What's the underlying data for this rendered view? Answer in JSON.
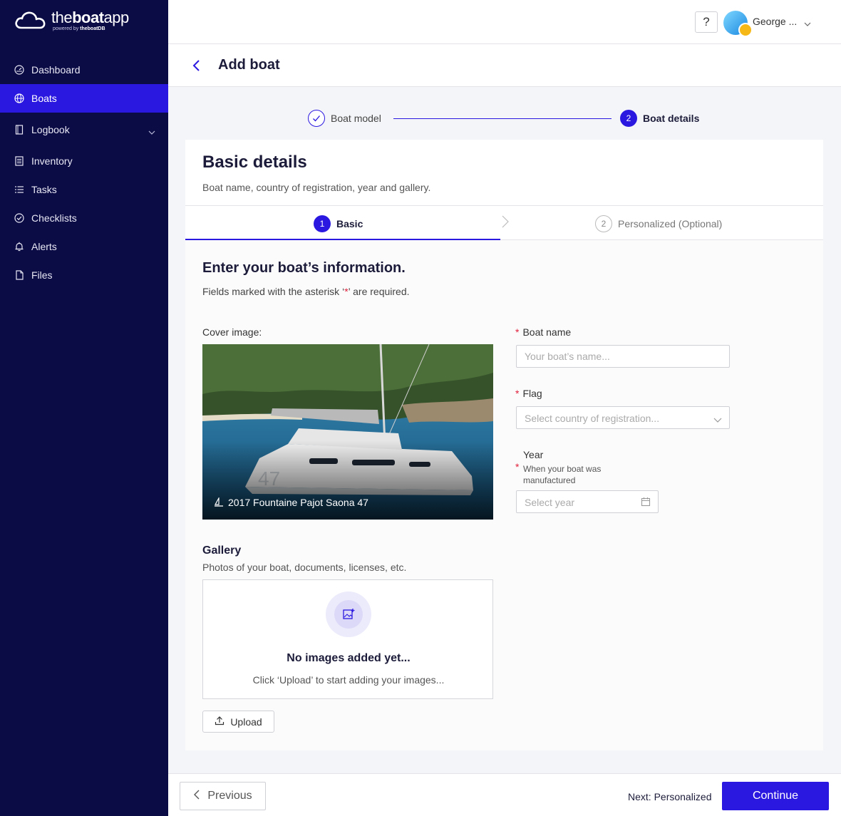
{
  "app": {
    "logo_main_light": "the",
    "logo_main_bold": "boat",
    "logo_main_tail": "app",
    "logo_sub_prefix": "powered by ",
    "logo_sub_brand": "theboatDB"
  },
  "sidebar": {
    "items": [
      {
        "label": "Dashboard",
        "icon": "dashboard-icon",
        "active": false
      },
      {
        "label": "Boats",
        "icon": "globe-icon",
        "active": true
      },
      {
        "label": "Logbook",
        "icon": "book-icon",
        "active": false,
        "expandable": true
      },
      {
        "label": "Inventory",
        "icon": "inventory-icon",
        "active": false
      },
      {
        "label": "Tasks",
        "icon": "list-icon",
        "active": false
      },
      {
        "label": "Checklists",
        "icon": "check-circle-icon",
        "active": false
      },
      {
        "label": "Alerts",
        "icon": "bell-icon",
        "active": false
      },
      {
        "label": "Files",
        "icon": "file-icon",
        "active": false
      }
    ]
  },
  "topbar": {
    "help_label": "?",
    "user_name": "George ..."
  },
  "header": {
    "title": "Add boat"
  },
  "stepper": {
    "step1_label": "Boat model",
    "step2_number": "2",
    "step2_label": "Boat details"
  },
  "card": {
    "title": "Basic details",
    "subtitle": "Boat name, country of registration, year and gallery.",
    "tabs": [
      {
        "number": "1",
        "label": "Basic",
        "active": true
      },
      {
        "number": "2",
        "label": "Personalized (Optional)",
        "active": false
      }
    ]
  },
  "form": {
    "title": "Enter your boat’s information.",
    "note_prefix": "Fields marked with the asterisk ‘",
    "note_asterisk": "*",
    "note_suffix": "’ are required.",
    "cover_label": "Cover image:",
    "cover_caption": "2017 Fountaine Pajot Saona 47",
    "boat_name_label": "Boat name",
    "boat_name_placeholder": "Your boat’s name...",
    "flag_label": "Flag",
    "flag_placeholder": "Select country of registration...",
    "year_label": "Year",
    "year_hint": "When your boat was manufactured",
    "year_placeholder": "Select year",
    "required_mark": "*"
  },
  "gallery": {
    "title": "Gallery",
    "subtitle": "Photos of your boat, documents, licenses, etc.",
    "empty_title": "No images added yet...",
    "empty_hint": "Click ‘Upload’ to start adding your images...",
    "upload_label": "Upload"
  },
  "footer": {
    "previous_label": "Previous",
    "next_label": "Next: Personalized",
    "continue_label": "Continue"
  },
  "colors": {
    "sidebar_bg": "#0b0b45",
    "accent": "#2b18e0",
    "required": "#e0203a"
  }
}
